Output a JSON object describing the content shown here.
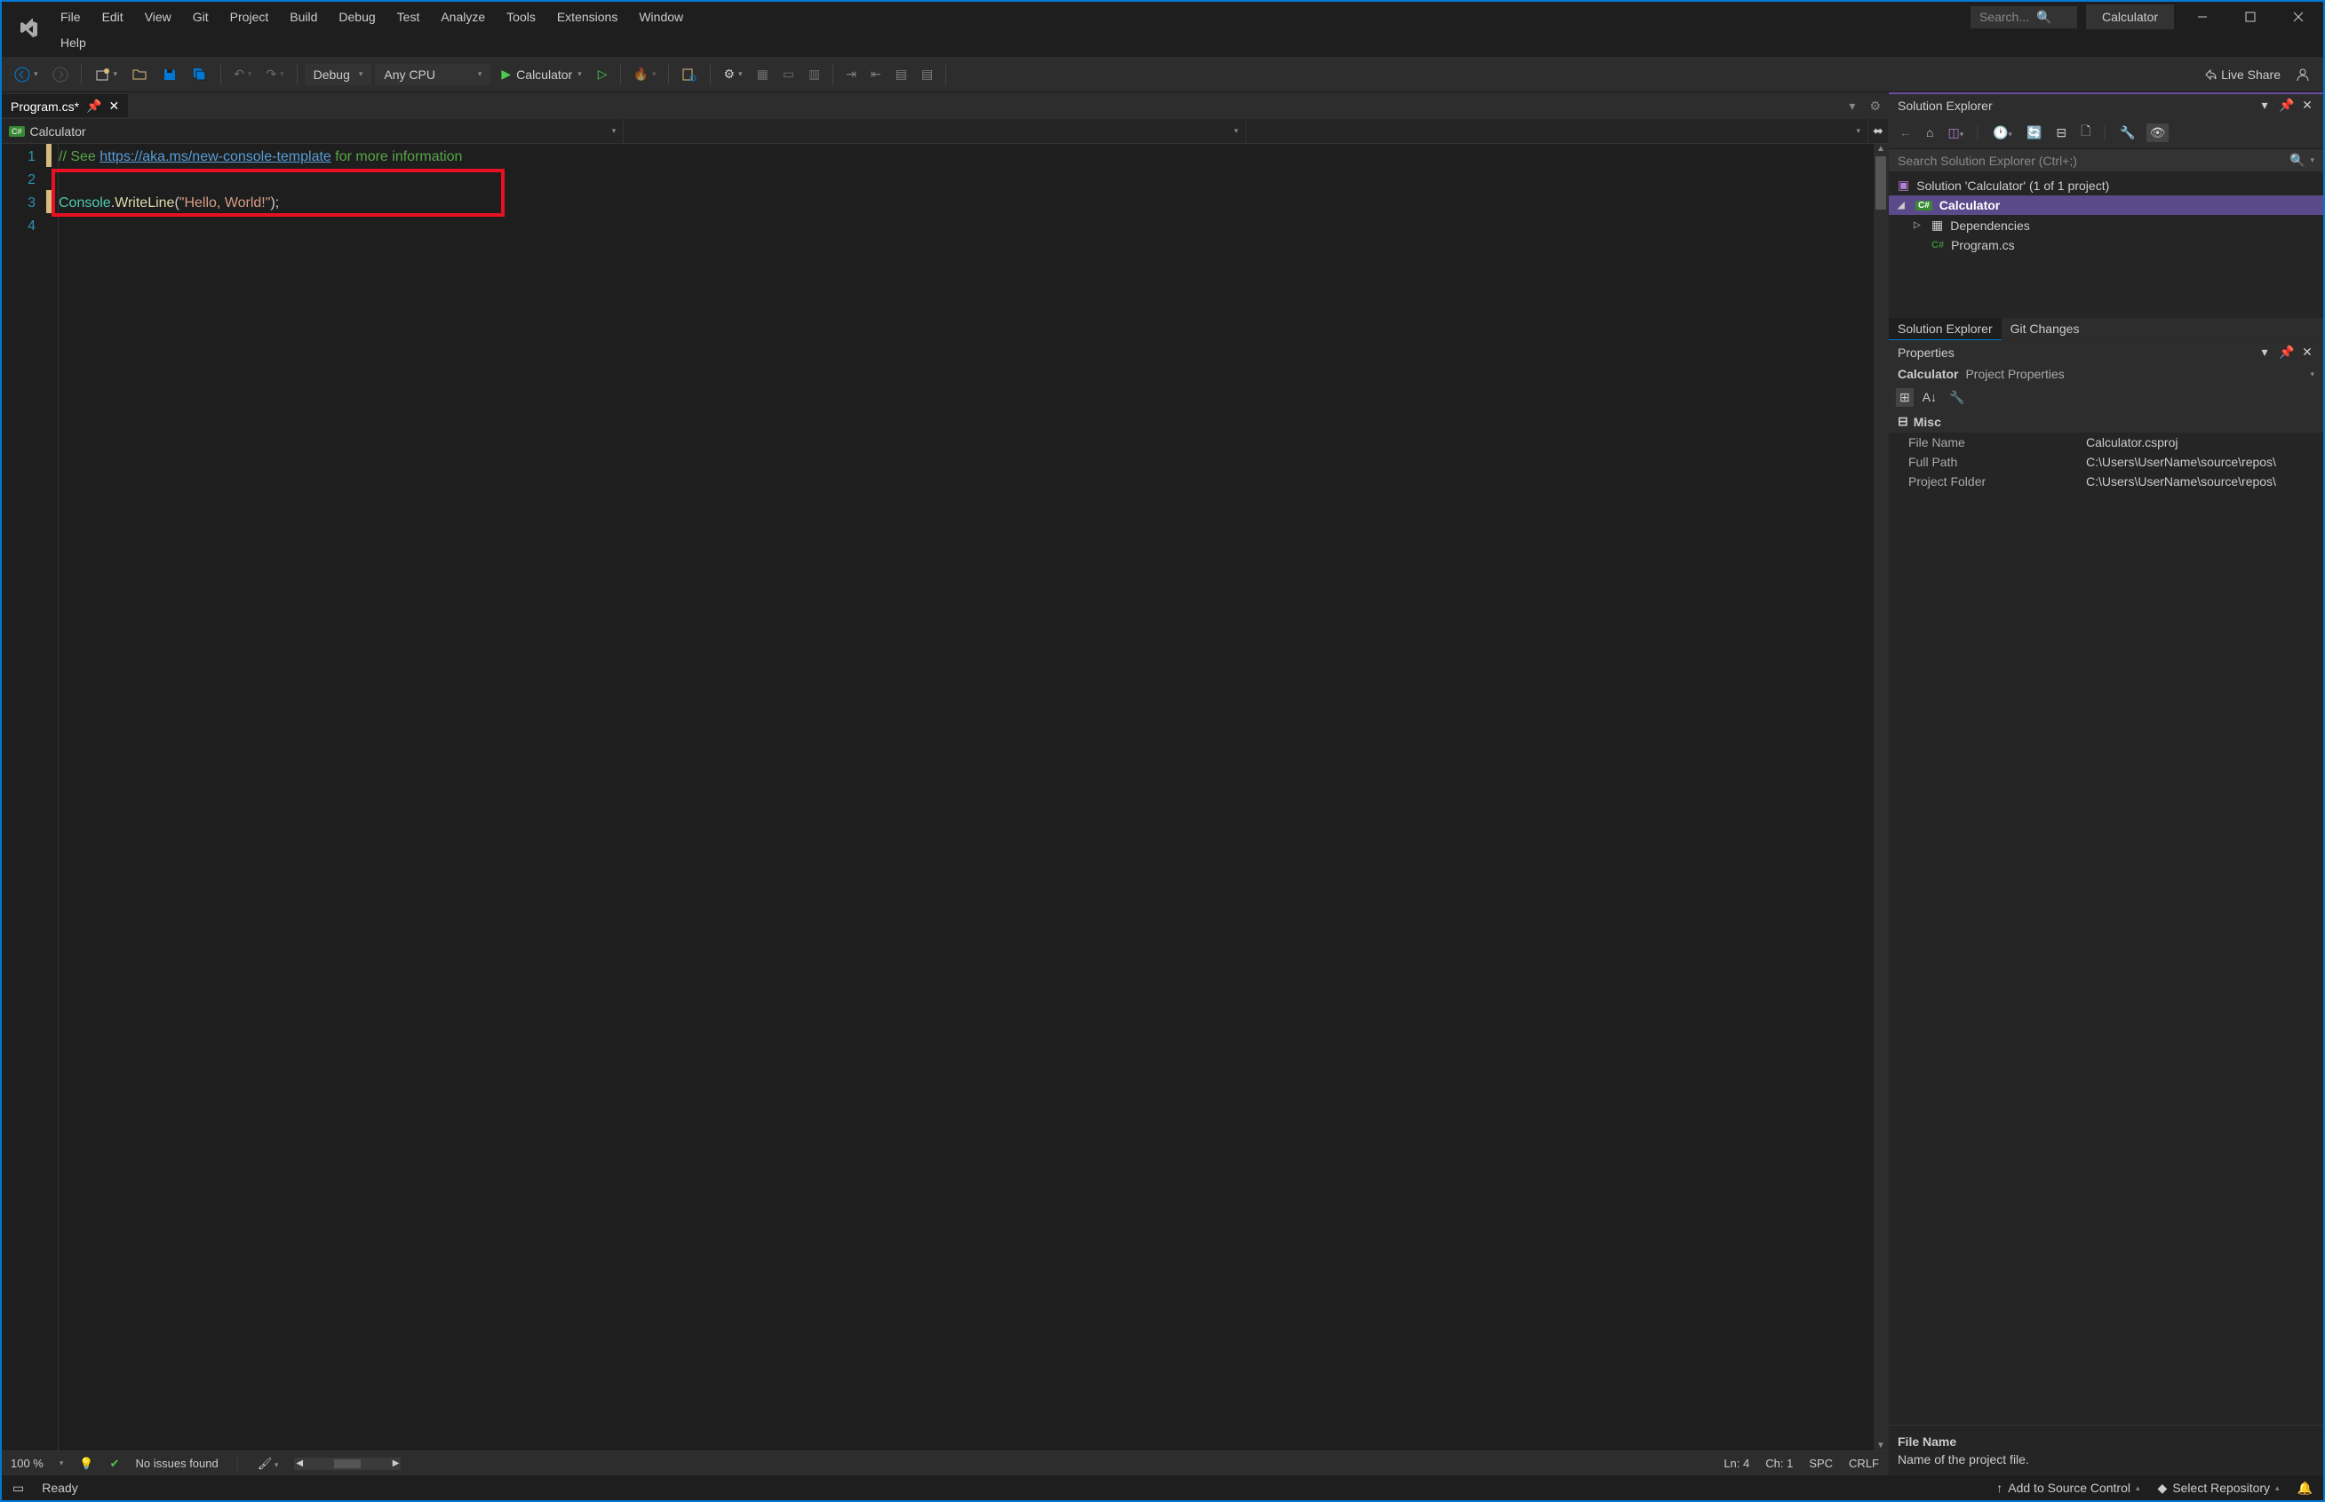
{
  "menu": [
    "File",
    "Edit",
    "View",
    "Git",
    "Project",
    "Build",
    "Debug",
    "Test",
    "Analyze",
    "Tools",
    "Extensions",
    "Window",
    "Help"
  ],
  "searchPlaceholder": "Search...",
  "appTitle": "Calculator",
  "toolbar": {
    "config": "Debug",
    "platform": "Any CPU",
    "startTarget": "Calculator",
    "liveShare": "Live Share"
  },
  "tab": {
    "name": "Program.cs*"
  },
  "nav": {
    "project": "Calculator"
  },
  "code": {
    "lines": [
      "1",
      "2",
      "3",
      "4"
    ],
    "commentPrefix": "// See ",
    "commentLink": "https://aka.ms/new-console-template",
    "commentSuffix": " for more information",
    "l3_type": "Console",
    "l3_dot": ".",
    "l3_method": "WriteLine",
    "l3_open": "(",
    "l3_str": "\"Hello, World!\"",
    "l3_close": ");"
  },
  "editorStatus": {
    "zoom": "100 %",
    "issues": "No issues found",
    "ln": "Ln: 4",
    "ch": "Ch: 1",
    "ind": "SPC",
    "eol": "CRLF"
  },
  "solutionExplorer": {
    "title": "Solution Explorer",
    "searchPlaceholder": "Search Solution Explorer (Ctrl+;)",
    "solution": "Solution 'Calculator' (1 of 1 project)",
    "project": "Calculator",
    "deps": "Dependencies",
    "file": "Program.cs",
    "tabs": [
      "Solution Explorer",
      "Git Changes"
    ]
  },
  "properties": {
    "title": "Properties",
    "subject": "Calculator",
    "subjectType": "Project Properties",
    "category": "Misc",
    "rows": [
      {
        "k": "File Name",
        "v": "Calculator.csproj"
      },
      {
        "k": "Full Path",
        "v": "C:\\Users\\UserName\\source\\repos\\"
      },
      {
        "k": "Project Folder",
        "v": "C:\\Users\\UserName\\source\\repos\\"
      }
    ],
    "descTitle": "File Name",
    "descText": "Name of the project file."
  },
  "statusbar": {
    "ready": "Ready",
    "addSource": "Add to Source Control",
    "selectRepo": "Select Repository"
  }
}
